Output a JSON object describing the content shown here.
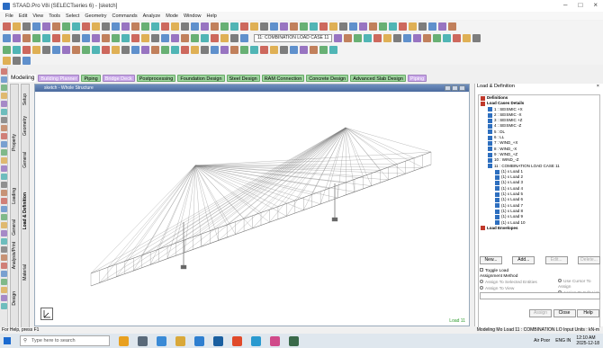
{
  "window": {
    "title": "STAAD.Pro V8i (SELECTseries 6) - [sketch]",
    "controls": [
      "–",
      "□",
      "×"
    ]
  },
  "menu": [
    "File",
    "Edit",
    "View",
    "Tools",
    "Select",
    "Geometry",
    "Commands",
    "Analyze",
    "Mode",
    "Window",
    "Help"
  ],
  "toolbar": {
    "load_case_combo": "11: COMBINATION LOAD CASE 11"
  },
  "mode_tabs": [
    {
      "label": "Modeling",
      "style": "plain"
    },
    {
      "label": "Building Planner",
      "style": "purple"
    },
    {
      "label": "Piping",
      "style": "green"
    },
    {
      "label": "Bridge Deck",
      "style": "purple"
    },
    {
      "label": "Postprocessing",
      "style": "green"
    },
    {
      "label": "Foundation Design",
      "style": "green"
    },
    {
      "label": "Steel Design",
      "style": "green"
    },
    {
      "label": "RAM Connection",
      "style": "green"
    },
    {
      "label": "Concrete Design",
      "style": "green"
    },
    {
      "label": "Advanced Slab Design",
      "style": "green"
    },
    {
      "label": "Piping",
      "style": "purple"
    }
  ],
  "vertical_tabs": {
    "col1": [
      "General",
      "Property",
      "Loading",
      "Analysis/Print",
      "Design"
    ],
    "col2": [
      "Setup",
      "Geometry",
      "General",
      "Load & Definition",
      "Material"
    ]
  },
  "viewport": {
    "title": "sketch - Whole Structure",
    "load_label": "Load 11"
  },
  "right_panel": {
    "title": "Load & Definition",
    "close": "×",
    "tree": [
      {
        "indent": 0,
        "label": "Definitions",
        "bold": true,
        "icon": "folder"
      },
      {
        "indent": 0,
        "label": "Load Cases Details",
        "bold": true,
        "icon": "folder"
      },
      {
        "indent": 1,
        "label": "1 : SEISMIC +X",
        "icon": "load"
      },
      {
        "indent": 1,
        "label": "2 : SEISMIC -X",
        "icon": "load"
      },
      {
        "indent": 1,
        "label": "3 : SEISMIC +Z",
        "icon": "load"
      },
      {
        "indent": 1,
        "label": "4 : SEISMIC -Z",
        "icon": "load"
      },
      {
        "indent": 1,
        "label": "5 : DL",
        "icon": "load"
      },
      {
        "indent": 1,
        "label": "6 : LL",
        "icon": "load"
      },
      {
        "indent": 1,
        "label": "7 : WIND_+X",
        "icon": "load"
      },
      {
        "indent": 1,
        "label": "8 : WIND_-X",
        "icon": "load"
      },
      {
        "indent": 1,
        "label": "9 : WIND_+Z",
        "icon": "load"
      },
      {
        "indent": 1,
        "label": "10 : WIND_-Z",
        "icon": "load"
      },
      {
        "indent": 1,
        "label": "11 : COMBINATION LOAD CASE 11",
        "icon": "combo"
      },
      {
        "indent": 2,
        "label": "(1) x Load 1",
        "icon": "item"
      },
      {
        "indent": 2,
        "label": "(1) x Load 2",
        "icon": "item"
      },
      {
        "indent": 2,
        "label": "(1) x Load 3",
        "icon": "item"
      },
      {
        "indent": 2,
        "label": "(1) x Load 4",
        "icon": "item"
      },
      {
        "indent": 2,
        "label": "(1) x Load 5",
        "icon": "item"
      },
      {
        "indent": 2,
        "label": "(1) x Load 6",
        "icon": "item"
      },
      {
        "indent": 2,
        "label": "(1) x Load 7",
        "icon": "item"
      },
      {
        "indent": 2,
        "label": "(1) x Load 8",
        "icon": "item"
      },
      {
        "indent": 2,
        "label": "(1) x Load 9",
        "icon": "item"
      },
      {
        "indent": 2,
        "label": "(1) x Load 10",
        "icon": "item"
      },
      {
        "indent": 0,
        "label": "Load Envelopes",
        "bold": true,
        "icon": "folder"
      }
    ],
    "buttons": {
      "new": "New...",
      "add": "Add...",
      "edit": "Edit...",
      "delete": "Delete..."
    },
    "toggle_load": "Toggle Load",
    "assignment_method": "Assignment Method",
    "assign_selected": "Assign To Selected Entities",
    "assign_view": "Assign To View",
    "use_cursor": "Use Cursor To Assign",
    "assign_edit": "Assign To Edit List",
    "assign_button": "Assign",
    "close_button": "Close",
    "help_button": "Help"
  },
  "status": {
    "left": "For Help, press F1",
    "right": "Modeling Mo Load 11 : COMBINATION LO Input Units : kN-m"
  },
  "taskbar": {
    "search_placeholder": "Type here to search",
    "air": "Air Poor",
    "lang": "ENG IN",
    "time": "12:10 AM",
    "date": "2025-12-18"
  }
}
